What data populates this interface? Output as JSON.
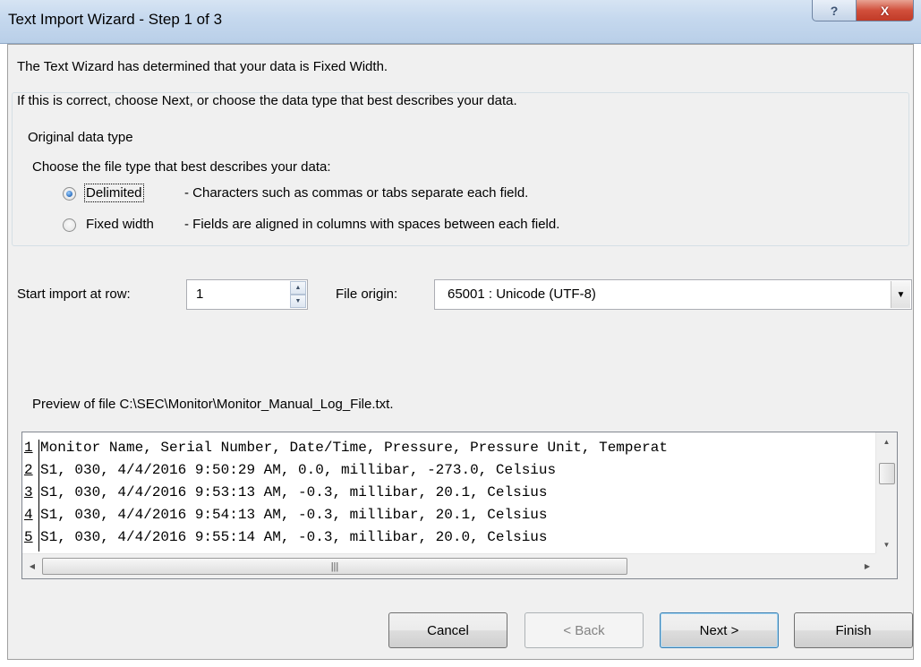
{
  "window": {
    "title": "Text Import Wizard - Step 1 of 3",
    "help_label": "?",
    "close_label": "X"
  },
  "intro": {
    "line1": "The Text Wizard has determined that your data is Fixed Width.",
    "line2": "If this is correct, choose Next, or choose the data type that best describes your data."
  },
  "original_data_type": {
    "legend": "Original data type",
    "prompt": "Choose the file type that best describes your data:",
    "options": [
      {
        "label": "Delimited",
        "description": "- Characters such as commas or tabs separate each field.",
        "selected": true
      },
      {
        "label": "Fixed width",
        "description": "- Fields are aligned in columns with spaces between each field.",
        "selected": false
      }
    ]
  },
  "start_row": {
    "label": "Start import at row:",
    "value": "1"
  },
  "file_origin": {
    "label": "File origin:",
    "value": "65001 : Unicode (UTF-8)"
  },
  "preview": {
    "label": "Preview of file C:\\SEC\\Monitor\\Monitor_Manual_Log_File.txt.",
    "rows": [
      {
        "num": "1",
        "text": "Monitor Name, Serial Number, Date/Time, Pressure, Pressure Unit, Temperat"
      },
      {
        "num": "2",
        "text": "S1, 030, 4/4/2016 9:50:29 AM, 0.0, millibar, -273.0, Celsius"
      },
      {
        "num": "3",
        "text": "S1, 030, 4/4/2016 9:53:13 AM, -0.3, millibar, 20.1, Celsius"
      },
      {
        "num": "4",
        "text": "S1, 030, 4/4/2016 9:54:13 AM, -0.3, millibar, 20.1, Celsius"
      },
      {
        "num": "5",
        "text": "S1, 030, 4/4/2016 9:55:14 AM, -0.3, millibar, 20.0, Celsius"
      }
    ]
  },
  "buttons": {
    "cancel": "Cancel",
    "back": "< Back",
    "next": "Next >",
    "finish": "Finish"
  }
}
